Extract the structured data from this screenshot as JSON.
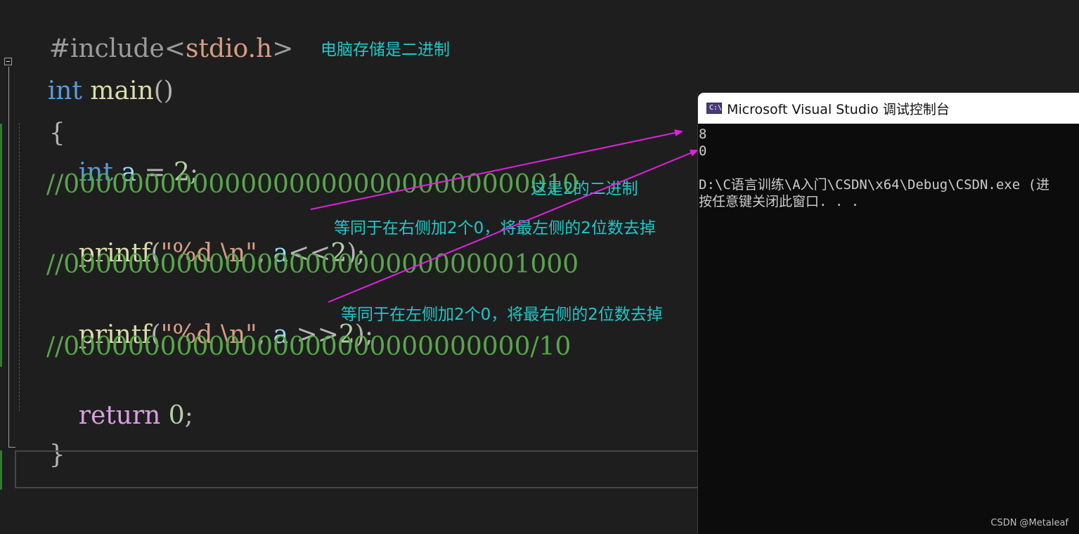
{
  "editor": {
    "include_line": {
      "hash": "#include",
      "lt": "<",
      "header": "stdio.h",
      "gt": ">"
    },
    "main_line": {
      "type": "int",
      "name": "main",
      "parens": "()"
    },
    "open_brace": "{",
    "decl_line": {
      "type": "int",
      "var": "a",
      "eq": "=",
      "value": "2",
      "semi": ";"
    },
    "comment_1": "//00000000000000000000000000000010",
    "printf_1": {
      "fn": "printf",
      "open": "(",
      "fmt": "\"%d \\n\"",
      "comma": ",",
      "arg": "a",
      "op": "<<",
      "num": "2",
      "close": ");"
    },
    "comment_2": "//00000000000000000000000000001000",
    "printf_2": {
      "fn": "printf",
      "open": "(",
      "fmt": "\"%d \\n\"",
      "comma": ",",
      "arg": "a",
      "op": ">>",
      "num": "2",
      "close": ");"
    },
    "comment_3": "//00000000000000000000000000000/10",
    "return_line": {
      "kw": "return",
      "value": "0",
      "semi": ";"
    },
    "close_brace": "}"
  },
  "annotations": {
    "binary_storage": "电脑存储是二进制",
    "binary_of_two": "这是2的二进制",
    "left_shift_note": "等同于在右侧加2个0，将最左侧的2位数去掉",
    "right_shift_note": "等同于在左侧加2个0，将最右侧的2位数去掉"
  },
  "arrow_color": "#e020e0",
  "console": {
    "icon_label": "C:\\",
    "title": "Microsoft Visual Studio 调试控制台",
    "output_line_1": "8",
    "output_line_2": "0",
    "exit_line": "D:\\C语言训练\\A入门\\CSDN\\x64\\Debug\\CSDN.exe (进",
    "close_prompt": "按任意键关闭此窗口. . ."
  },
  "watermark": "CSDN @Metaleaf"
}
